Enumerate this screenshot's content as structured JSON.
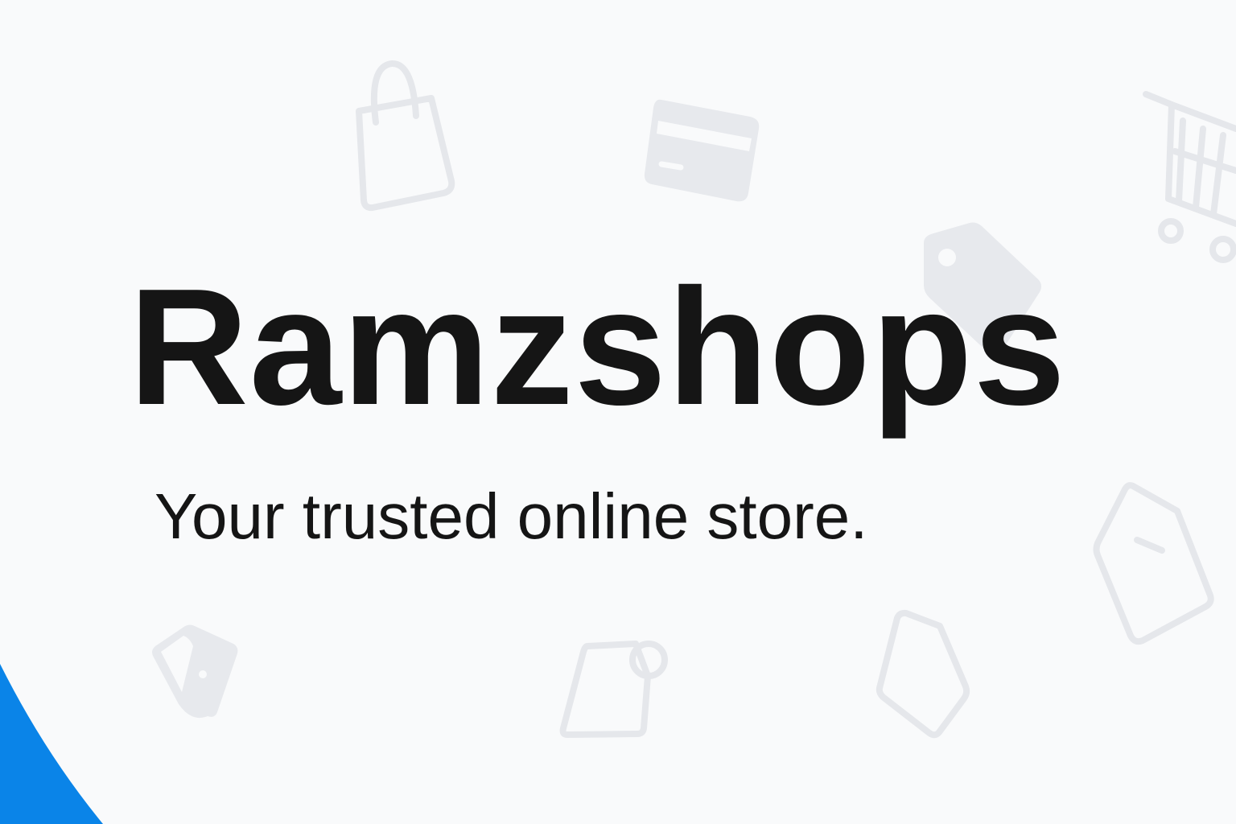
{
  "brand": {
    "name": "Ramzshops",
    "tagline": "Your trusted online store."
  },
  "icons": [
    "shopping-bag-icon",
    "credit-card-icon",
    "shopping-cart-icon",
    "price-tag-icon",
    "receipt-icon",
    "small-tag-icon",
    "label-tag-icon",
    "pentagon-tag-icon"
  ],
  "colors": {
    "background": "#f9fafb",
    "text": "#151515",
    "icon": "#e5e7eb",
    "accent": "#0a84e8"
  }
}
